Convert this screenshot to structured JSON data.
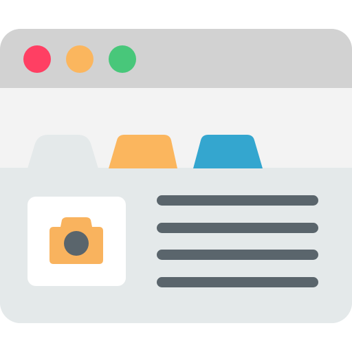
{
  "window": {
    "titlebar_buttons": [
      {
        "name": "close",
        "color": "#ff3f63"
      },
      {
        "name": "minimize",
        "color": "#fbb65e"
      },
      {
        "name": "maximize",
        "color": "#48c77a"
      }
    ]
  },
  "tabs": [
    {
      "name": "tab-1",
      "color": "#e4e9ea",
      "active": true
    },
    {
      "name": "tab-2",
      "color": "#fbb65e",
      "active": false
    },
    {
      "name": "tab-3",
      "color": "#34a6cf",
      "active": false
    }
  ],
  "content": {
    "thumbnail_icon": "camera-icon",
    "thumbnail_icon_color": "#f9b35e",
    "text_line_count": 4,
    "text_line_color": "#5a656c"
  }
}
